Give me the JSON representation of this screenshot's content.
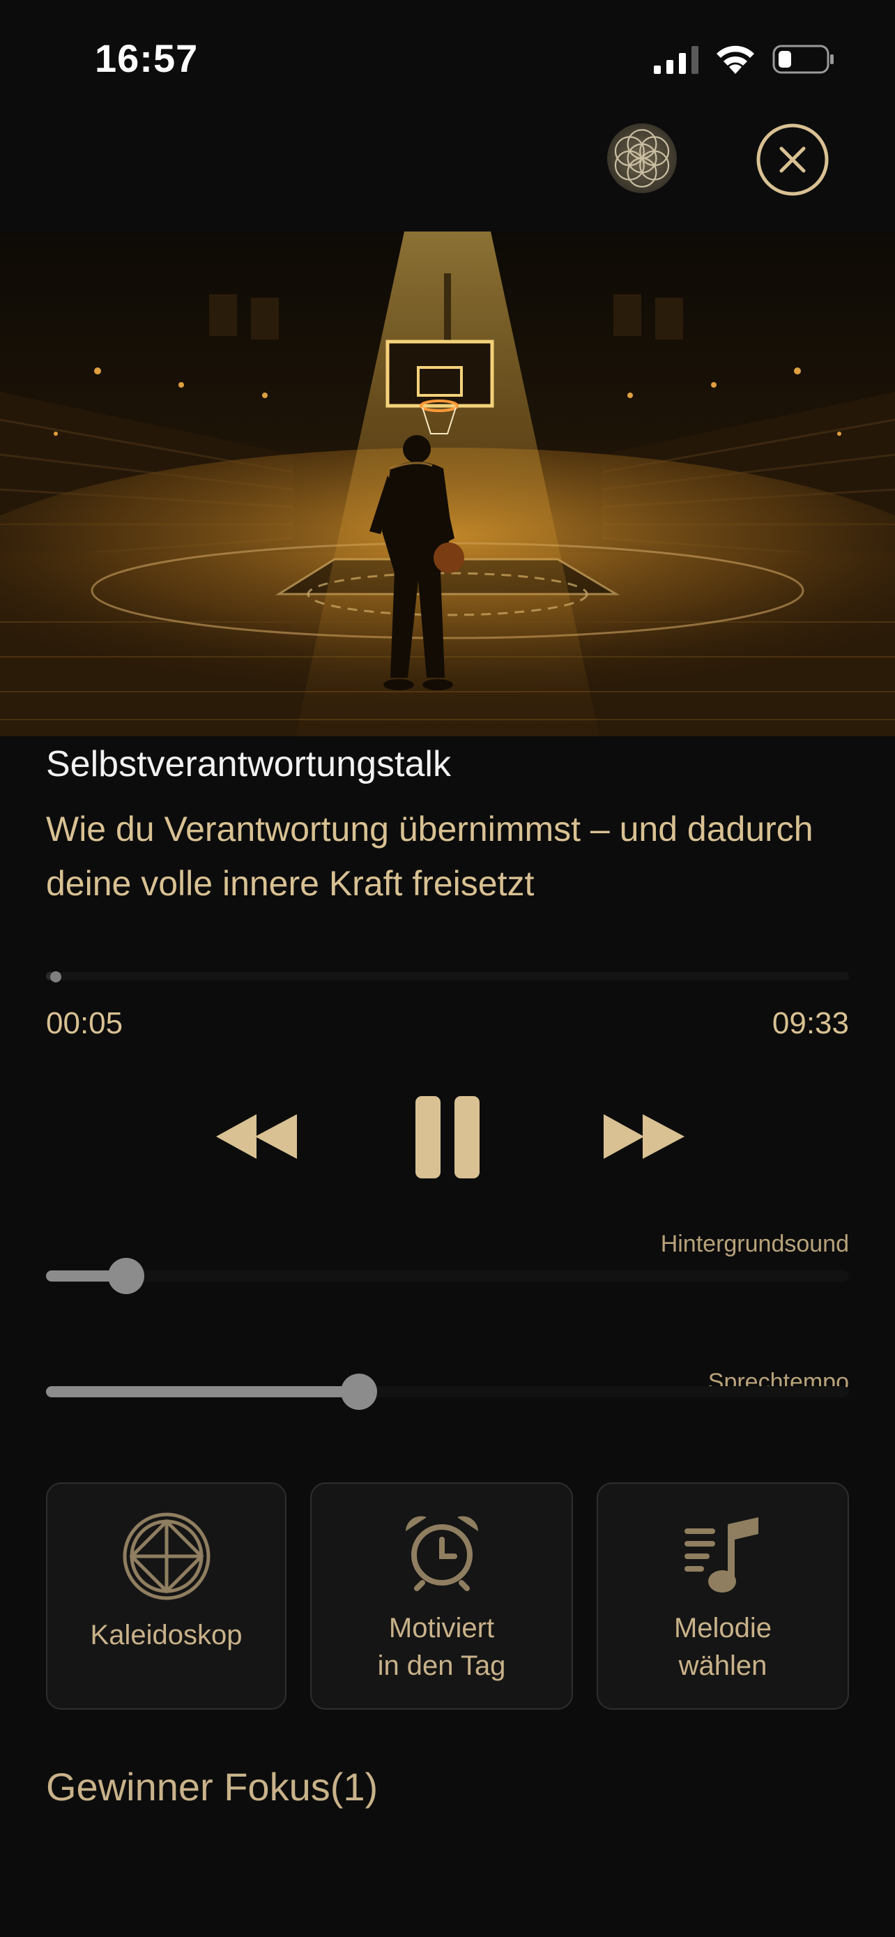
{
  "status_bar": {
    "time": "16:57"
  },
  "player": {
    "category": "Selbstverantwortungstalk",
    "title": "Wie du Verantwortung übernimmst – und dadurch deine volle innere Kraft freisetzt",
    "current_time": "00:05",
    "total_time": "09:33",
    "progress_fraction": 0.009
  },
  "sliders": {
    "background_sound": {
      "label": "Hintergrundsound",
      "value_fraction": 0.1
    },
    "speech_tempo": {
      "label": "Sprechtempo",
      "value_fraction": 0.39
    }
  },
  "options": [
    {
      "label": "Kaleidoskop",
      "icon": "kaleidoscope-icon"
    },
    {
      "label": "Motiviert\nin den Tag",
      "icon": "alarm-clock-icon"
    },
    {
      "label": "Melodie\nwählen",
      "icon": "music-note-icon"
    }
  ],
  "section": {
    "title": "Gewinner Fokus(1)"
  },
  "colors": {
    "accent": "#d9c193",
    "background": "#0c0c0c",
    "card": "#151515"
  }
}
